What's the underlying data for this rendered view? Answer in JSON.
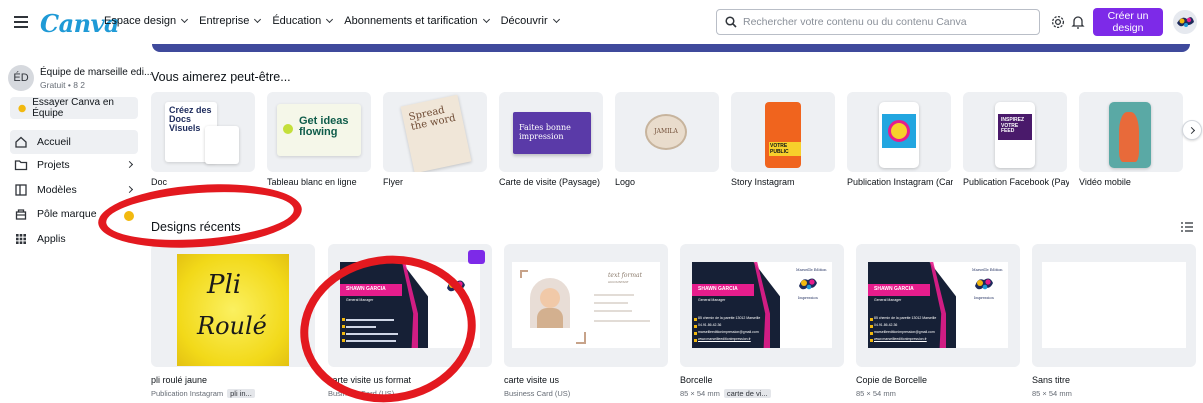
{
  "header": {
    "logo": "Canva",
    "nav": [
      "Espace design",
      "Entreprise",
      "Éducation",
      "Abonnements et tarification",
      "Découvrir"
    ],
    "search_placeholder": "Rechercher votre contenu ou du contenu Canva",
    "cta": "Créer un design"
  },
  "sidebar": {
    "team_initials": "ÉD",
    "team_name": "Équipe de marseille edi...",
    "team_meta": "Gratuit • 8 2",
    "try_team": "Essayer Canva en Équipe",
    "items": [
      "Accueil",
      "Projets",
      "Modèles",
      "Pôle marque",
      "Applis"
    ]
  },
  "suggestions": {
    "title": "Vous aimerez peut-être...",
    "items": [
      "Doc",
      "Tableau blanc en ligne",
      "Flyer",
      "Carte de visite (Paysage)",
      "Logo",
      "Story Instagram",
      "Publication Instagram (Car...",
      "Publication Facebook (Pay...",
      "Vidéo mobile"
    ],
    "doc_thumb_text": "Créez des Docs Visuels",
    "wb_thumb_text": "Get ideas flowing",
    "flyer_thumb_text": "Spread the word",
    "bc_thumb_text": "Faites bonne impression",
    "logo_thumb_text": "JAMILA",
    "story_thumb_text": "VOTRE PUBLIC",
    "fb_thumb_text": "INSPIREZ VOTRE FEED"
  },
  "recent": {
    "title": "Designs récents",
    "items": [
      {
        "title": "pli roulé jaune",
        "meta": "Publication Instagram",
        "tag": "pli in..."
      },
      {
        "title": "carte visite us format",
        "meta": "Business Card (US)",
        "tag": ""
      },
      {
        "title": "carte visite us",
        "meta": "Business Card (US)",
        "tag": ""
      },
      {
        "title": "Borcelle",
        "meta": "85 × 54 mm",
        "tag": "carte de vi..."
      },
      {
        "title": "Copie de Borcelle",
        "meta": "85 × 54 mm",
        "tag": ""
      },
      {
        "title": "Sans titre",
        "meta": "85 × 54 mm",
        "tag": ""
      }
    ],
    "pli_text_1": "Pli",
    "pli_text_2": "Roulé",
    "bc_name": "SHAWN GARCIA",
    "bc_role": "General Manager",
    "bc_brand": "Marseille Edition",
    "bc_brand2": "Impression",
    "bc_address": "85 chemin de la parette 13012 Marseille",
    "bc_phone": "04.91.86.42.36",
    "bc_email": "marseilleeditionimpression@gmail.com",
    "bc_web": "www.marseilleeditionimpression.fr",
    "us_name": "text format",
    "us_role": "ACCOUNTANT"
  },
  "colors": {
    "accent": "#7d2ae8",
    "annotation": "#e3191f",
    "navy": "#162036",
    "magenta": "#e61d8c"
  }
}
